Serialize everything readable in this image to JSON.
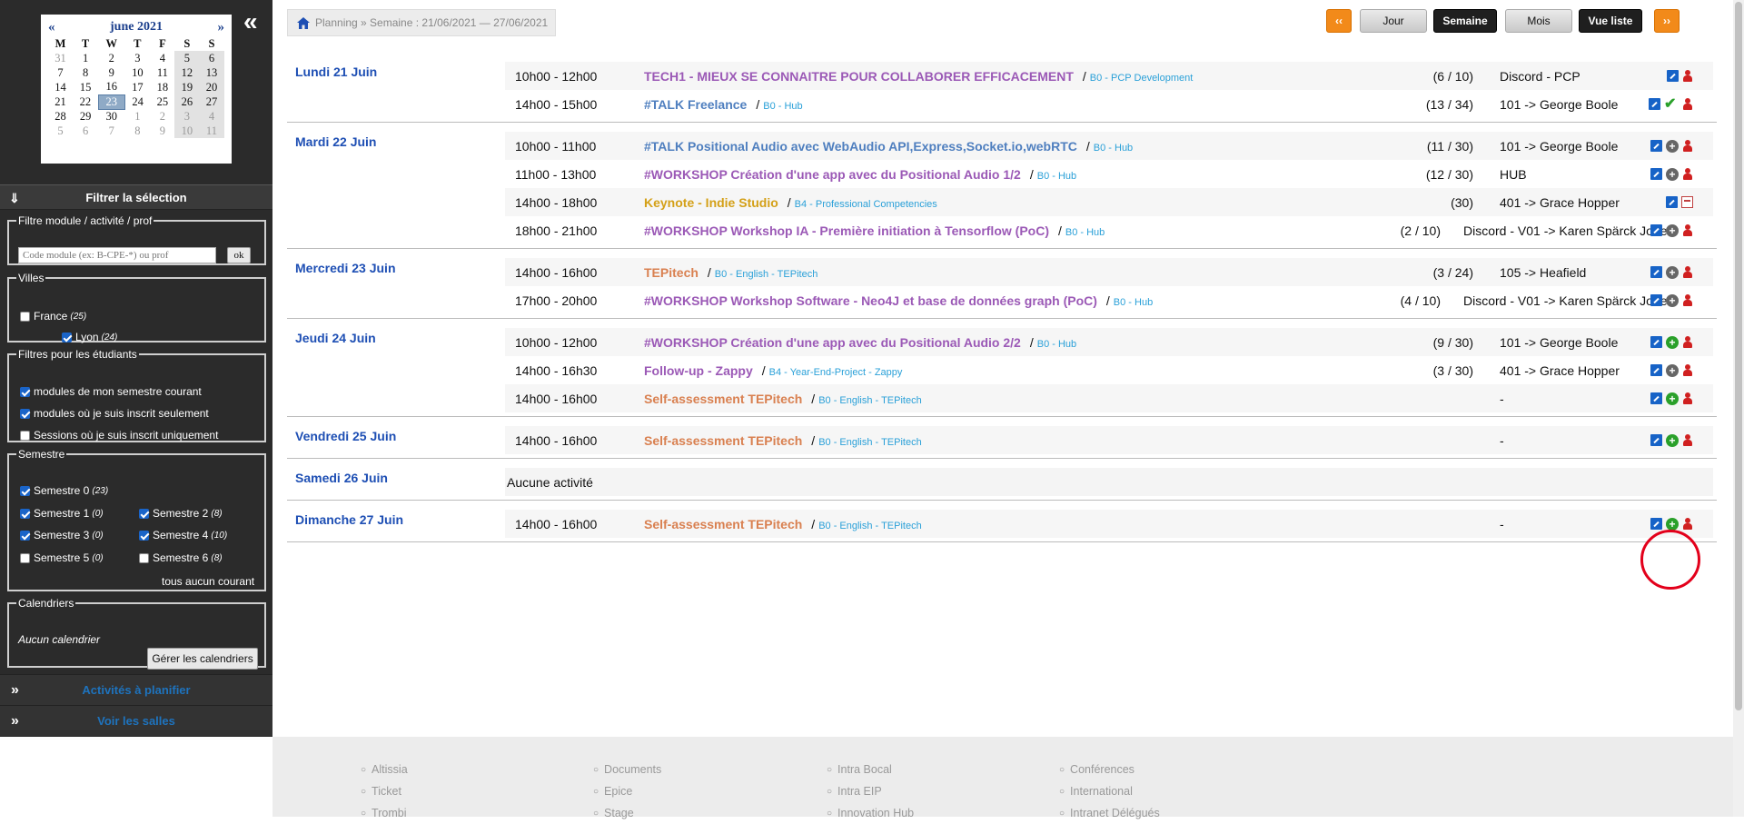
{
  "calendar": {
    "month": "june 2021",
    "prev": "«",
    "next": "»",
    "weekdays": [
      "M",
      "T",
      "W",
      "T",
      "F",
      "S",
      "S"
    ],
    "weeks": [
      [
        "31",
        "1",
        "2",
        "3",
        "4",
        "5",
        "6"
      ],
      [
        "7",
        "8",
        "9",
        "10",
        "11",
        "12",
        "13"
      ],
      [
        "14",
        "15",
        "16",
        "17",
        "18",
        "19",
        "20"
      ],
      [
        "21",
        "22",
        "23",
        "24",
        "25",
        "26",
        "27"
      ],
      [
        "28",
        "29",
        "30",
        "1",
        "2",
        "3",
        "4"
      ],
      [
        "5",
        "6",
        "7",
        "8",
        "9",
        "10",
        "11"
      ]
    ],
    "today": "23"
  },
  "sidebar": {
    "collapse": "«",
    "filter_title": "Filtrer la sélection",
    "module_filter": {
      "legend": "Filtre module / activité / prof",
      "placeholder": "Code module (ex: B-CPE-*) ou prof",
      "ok": "ok"
    },
    "cities": {
      "legend": "Villes",
      "items": [
        {
          "label": "France",
          "count": "(25)",
          "checked": false
        },
        {
          "label": "Lyon",
          "count": "(24)",
          "checked": true
        }
      ]
    },
    "student_filters": {
      "legend": "Filtres pour les étudiants",
      "items": [
        {
          "label": "modules de mon semestre courant",
          "checked": true
        },
        {
          "label": "modules où je suis inscrit seulement",
          "checked": true
        },
        {
          "label": "Sessions où je suis inscrit uniquement",
          "checked": false
        }
      ]
    },
    "semesters": {
      "legend": "Semestre",
      "items": [
        {
          "label": "Semestre 0",
          "count": "(23)",
          "checked": true
        },
        {
          "label": "Semestre 1",
          "count": "(0)",
          "checked": true
        },
        {
          "label": "Semestre 2",
          "count": "(8)",
          "checked": true
        },
        {
          "label": "Semestre 3",
          "count": "(0)",
          "checked": true
        },
        {
          "label": "Semestre 4",
          "count": "(10)",
          "checked": true
        },
        {
          "label": "Semestre 5",
          "count": "(0)",
          "checked": false
        },
        {
          "label": "Semestre 6",
          "count": "(8)",
          "checked": false
        }
      ],
      "links": "tous aucun courant"
    },
    "calendars": {
      "legend": "Calendriers",
      "empty": "Aucun calendrier",
      "manage": "Gérer les calendriers"
    },
    "activities_to_plan": "Activités à planifier",
    "rooms": "Voir les salles"
  },
  "breadcrumb": {
    "text": "Planning » Semaine : 21/06/2021 — 27/06/2021"
  },
  "view_buttons": {
    "prev": "‹‹",
    "day": "Jour",
    "week": "Semaine",
    "month": "Mois",
    "list": "Vue liste",
    "next": "››"
  },
  "days": [
    {
      "name": "Lundi 21 Juin",
      "events": [
        {
          "time": "10h00 - 12h00",
          "title": "TECH1 - MIEUX SE CONNAITRE POUR COLLABORER EFFICACEMENT",
          "module": "B0 - PCP Development",
          "color": "purple",
          "count": "(6 / 10)",
          "room": "Discord - PCP",
          "actions": [
            "edit",
            "user"
          ]
        },
        {
          "time": "14h00 - 15h00",
          "title": "#TALK Freelance",
          "module": "B0 - Hub",
          "color": "blue",
          "count": "(13 / 34)",
          "room": "101 -> George Boole",
          "actions": [
            "edit",
            "check",
            "user"
          ]
        }
      ]
    },
    {
      "name": "Mardi 22 Juin",
      "events": [
        {
          "time": "10h00 - 11h00",
          "title": "#TALK Positional Audio avec WebAudio API,Express,Socket.io,webRTC",
          "module": "B0 - Hub",
          "color": "blue",
          "count": "(11 / 30)",
          "room": "101 -> George Boole",
          "actions": [
            "edit",
            "plus",
            "user"
          ]
        },
        {
          "time": "11h00 - 13h00",
          "title": "#WORKSHOP Création d'une app avec du Positional Audio 1/2",
          "module": "B0 - Hub",
          "color": "purple",
          "count": "(12 / 30)",
          "room": "HUB",
          "actions": [
            "edit",
            "plus",
            "user"
          ]
        },
        {
          "time": "14h00 - 18h00",
          "title": "Keynote - Indie Studio",
          "module": "B4 - Professional Competencies",
          "color": "gold",
          "count": "(30)",
          "room": "401 -> Grace Hopper",
          "actions": [
            "edit",
            "cal"
          ]
        },
        {
          "time": "18h00 - 21h00",
          "title": "#WORKSHOP Workshop IA - Première initiation à Tensorflow (PoC)",
          "module": "B0 - Hub",
          "color": "purple",
          "count": "(2 / 10)",
          "room": "Discord - V01 -> Karen Spärck Jones",
          "actions": [
            "edit",
            "plus",
            "user"
          ]
        }
      ]
    },
    {
      "name": "Mercredi 23 Juin",
      "events": [
        {
          "time": "14h00 - 16h00",
          "title": "TEPitech",
          "module": "B0 - English - TEPitech",
          "color": "salmon",
          "count": "(3 / 24)",
          "room": "105 -> Heafield",
          "actions": [
            "edit",
            "plus",
            "user"
          ]
        },
        {
          "time": "17h00 - 20h00",
          "title": "#WORKSHOP Workshop Software - Neo4J et base de données graph (PoC)",
          "module": "B0 - Hub",
          "color": "purple",
          "count": "(4 / 10)",
          "room": "Discord - V01 -> Karen Spärck Jones",
          "actions": [
            "edit",
            "plus",
            "user"
          ]
        }
      ]
    },
    {
      "name": "Jeudi 24 Juin",
      "events": [
        {
          "time": "10h00 - 12h00",
          "title": "#WORKSHOP Création d'une app avec du Positional Audio 2/2",
          "module": "B0 - Hub",
          "color": "purple",
          "count": "(9 / 30)",
          "room": "101 -> George Boole",
          "actions": [
            "edit",
            "plusg",
            "user"
          ]
        },
        {
          "time": "14h00 - 16h30",
          "title": "Follow-up - Zappy",
          "module": "B4 - Year-End-Project - Zappy",
          "color": "purple",
          "count": "(3 / 30)",
          "room": "401 -> Grace Hopper",
          "actions": [
            "edit",
            "plus",
            "user"
          ]
        },
        {
          "time": "14h00 - 16h00",
          "title": "Self-assessment TEPitech",
          "module": "B0 - English - TEPitech",
          "color": "salmon",
          "count": "",
          "room": "-",
          "actions": [
            "edit",
            "plusg",
            "user"
          ]
        }
      ]
    },
    {
      "name": "Vendredi 25 Juin",
      "events": [
        {
          "time": "14h00 - 16h00",
          "title": "Self-assessment TEPitech",
          "module": "B0 - English - TEPitech",
          "color": "salmon",
          "count": "",
          "room": "-",
          "actions": [
            "edit",
            "plusg",
            "user"
          ]
        }
      ]
    },
    {
      "name": "Samedi 26 Juin",
      "empty": "Aucune activité",
      "events": []
    },
    {
      "name": "Dimanche 27 Juin",
      "events": [
        {
          "time": "14h00 - 16h00",
          "title": "Self-assessment TEPitech",
          "module": "B0 - English - TEPitech",
          "color": "salmon",
          "count": "",
          "room": "-",
          "actions": [
            "edit",
            "plusg",
            "user"
          ]
        }
      ]
    }
  ],
  "footer": {
    "columns": [
      [
        "Altissia",
        "Ticket",
        "Trombi"
      ],
      [
        "Documents",
        "Epice",
        "Stage"
      ],
      [
        "Intra Bocal",
        "Intra EIP",
        "Innovation Hub"
      ],
      [
        "Conférences",
        "International",
        "Intranet Délégués"
      ]
    ]
  },
  "colors": {
    "sidebar_bg": "#2b2b2b",
    "day_title": "#1e4fb4",
    "orange": "#f28a1a",
    "highlight": "#e3001b"
  }
}
